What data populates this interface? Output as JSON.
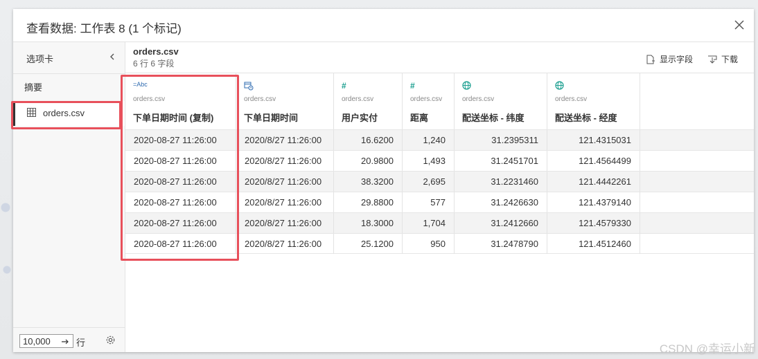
{
  "dialog": {
    "title": "查看数据: 工作表 8 (1 个标记)"
  },
  "sidebar": {
    "tabs_label": "选项卡",
    "summary_label": "摘要",
    "file": {
      "name": "orders.csv",
      "icon": "table-icon"
    },
    "row_limit": "10,000",
    "row_unit": "行"
  },
  "main": {
    "source_name": "orders.csv",
    "source_meta": "6 行 6 字段",
    "show_fields_label": "显示字段",
    "download_label": "下载"
  },
  "table": {
    "columns": [
      {
        "type": "string",
        "type_icon_text": "=Abc",
        "source": "orders.csv",
        "name": "下单日期时间 (复制)"
      },
      {
        "type": "datetime",
        "type_icon_text": "",
        "source": "orders.csv",
        "name": "下单日期时间"
      },
      {
        "type": "number",
        "type_icon_text": "#",
        "source": "orders.csv",
        "name": "用户实付"
      },
      {
        "type": "number",
        "type_icon_text": "#",
        "source": "orders.csv",
        "name": "距离"
      },
      {
        "type": "geo",
        "type_icon_text": "",
        "source": "orders.csv",
        "name": "配送坐标 - 纬度"
      },
      {
        "type": "geo",
        "type_icon_text": "",
        "source": "orders.csv",
        "name": "配送坐标 - 经度"
      }
    ],
    "rows": [
      [
        "2020-08-27 11:26:00",
        "2020/8/27 11:26:00",
        "16.6200",
        "1,240",
        "31.2395311",
        "121.4315031"
      ],
      [
        "2020-08-27 11:26:00",
        "2020/8/27 11:26:00",
        "20.9800",
        "1,493",
        "31.2451701",
        "121.4564499"
      ],
      [
        "2020-08-27 11:26:00",
        "2020/8/27 11:26:00",
        "38.3200",
        "2,695",
        "31.2231460",
        "121.4442261"
      ],
      [
        "2020-08-27 11:26:00",
        "2020/8/27 11:26:00",
        "29.8800",
        "577",
        "31.2426630",
        "121.4379140"
      ],
      [
        "2020-08-27 11:26:00",
        "2020/8/27 11:26:00",
        "18.3000",
        "1,704",
        "31.2412660",
        "121.4579330"
      ],
      [
        "2020-08-27 11:26:00",
        "2020/8/27 11:26:00",
        "25.1200",
        "950",
        "31.2478790",
        "121.4512460"
      ]
    ]
  },
  "watermark": "CSDN @幸运小新",
  "colors": {
    "highlight": "#e8505b",
    "number_icon": "#1a9e8f",
    "date_icon": "#2e6bb0"
  }
}
